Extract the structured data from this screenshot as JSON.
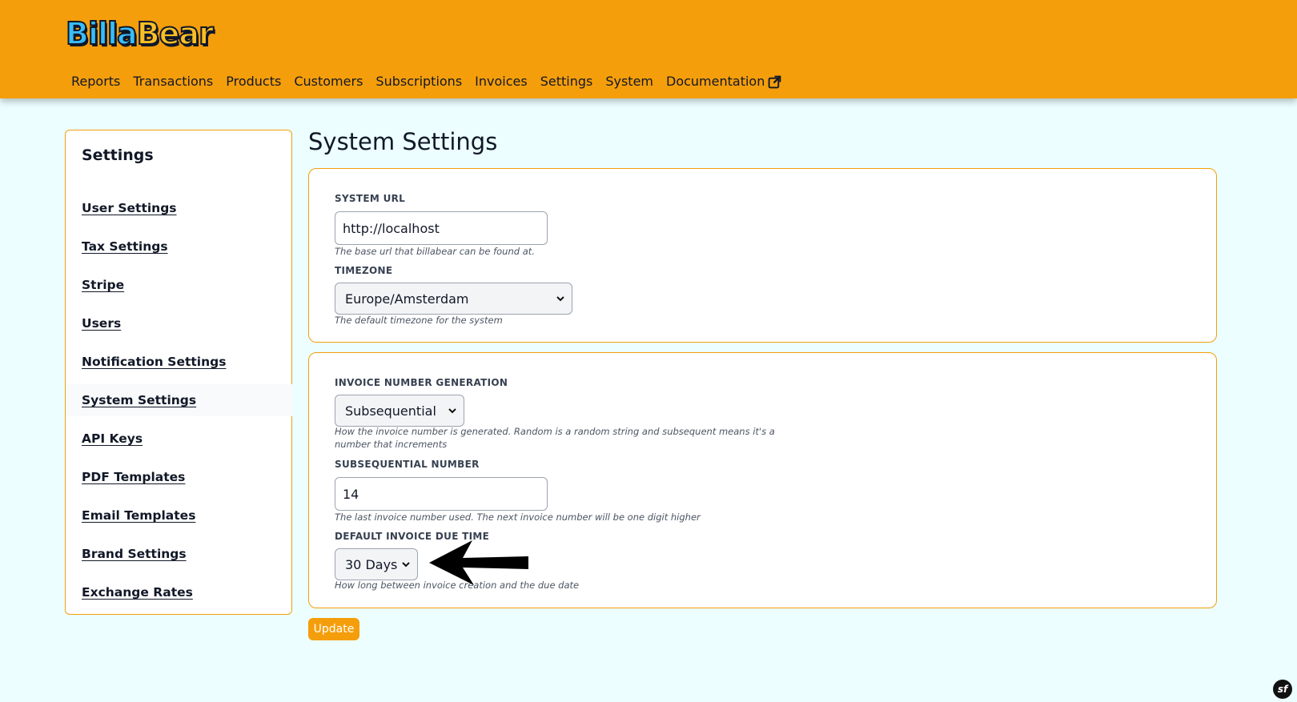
{
  "brand": {
    "logo_text_1": "Billa",
    "logo_text_2": "Bear",
    "accent_color": "#f59e0b",
    "background": "#ecfeff"
  },
  "nav": {
    "items": [
      "Reports",
      "Transactions",
      "Products",
      "Customers",
      "Subscriptions",
      "Invoices",
      "Settings",
      "System",
      "Documentation"
    ],
    "external_icon": "external-link-icon"
  },
  "sidebar": {
    "title": "Settings",
    "items": [
      {
        "label": "User Settings"
      },
      {
        "label": "Tax Settings"
      },
      {
        "label": "Stripe"
      },
      {
        "label": "Users"
      },
      {
        "label": "Notification Settings"
      },
      {
        "label": "System Settings"
      },
      {
        "label": "API Keys"
      },
      {
        "label": "PDF Templates"
      },
      {
        "label": "Email Templates"
      },
      {
        "label": "Brand Settings"
      },
      {
        "label": "Exchange Rates"
      }
    ],
    "active": "System Settings"
  },
  "main": {
    "title": "System Settings",
    "system_url": {
      "label": "SYSTEM URL",
      "value": "http://localhost",
      "help": "The base url that billabear can be found at."
    },
    "timezone": {
      "label": "TIMEZONE",
      "value": "Europe/Amsterdam",
      "help": "The default timezone for the system"
    },
    "invoice_number_generation": {
      "label": "INVOICE NUMBER GENERATION",
      "value": "Subsequential",
      "help_line1": "How the invoice number is generated. Random is a random string and subsequent means it's a",
      "help_line2": "number that increments"
    },
    "subsequential_number": {
      "label": "SUBSEQUENTIAL NUMBER",
      "value": "14",
      "help": "The last invoice number used. The next invoice number will be one digit higher"
    },
    "default_invoice_due_time": {
      "label": "DEFAULT INVOICE DUE TIME",
      "value": "30 Days",
      "help": "How long between invoice creation and the due date"
    },
    "update_label": "Update"
  }
}
